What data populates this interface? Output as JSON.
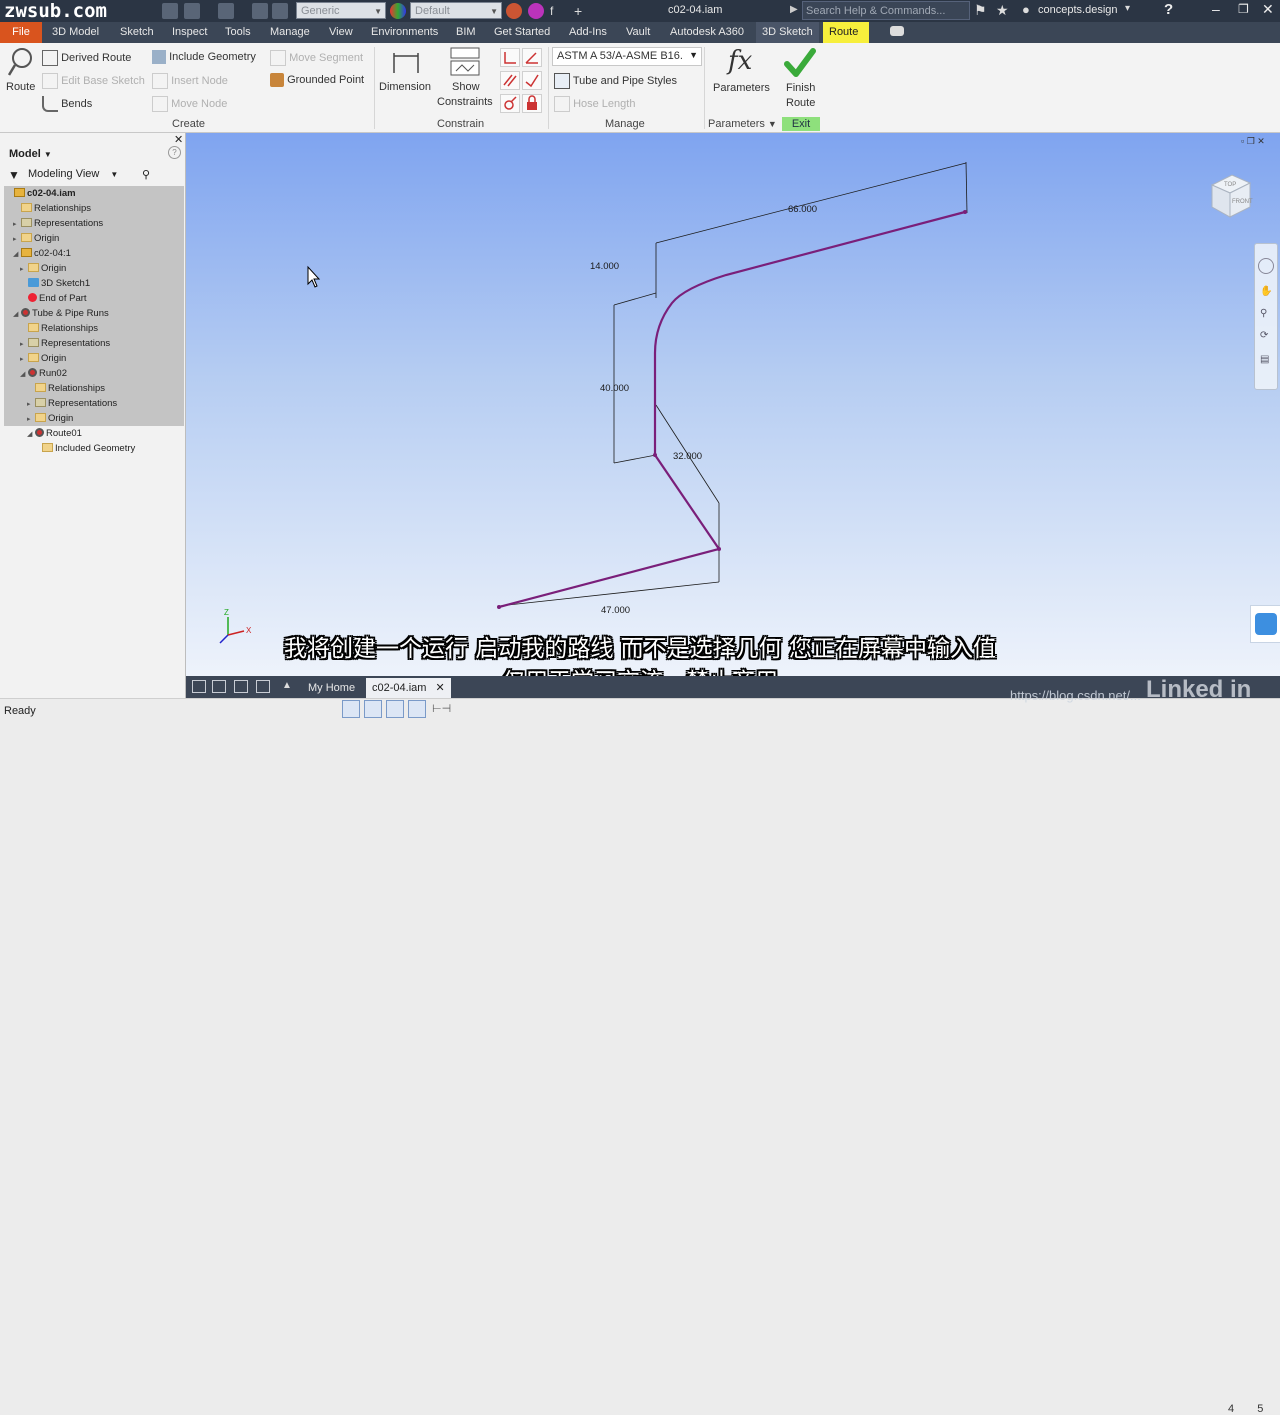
{
  "titlebar": {
    "logo": "zwsub.com",
    "combo_generic": "Generic",
    "combo_default": "Default",
    "doc_title": "c02-04.iam",
    "search_placeholder": "Search Help & Commands...",
    "user": "concepts.design"
  },
  "menu": {
    "items": [
      "File",
      "3D Model",
      "Sketch",
      "Inspect",
      "Tools",
      "Manage",
      "View",
      "Environments",
      "BIM",
      "Get Started",
      "Add-Ins",
      "Vault",
      "Autodesk A360",
      "3D Sketch",
      "Route"
    ],
    "active": "Route"
  },
  "ribbon": {
    "route": "Route",
    "derived_route": "Derived Route",
    "include_geometry": "Include Geometry",
    "move_segment": "Move Segment",
    "edit_base_sketch": "Edit Base Sketch",
    "insert_node": "Insert Node",
    "grounded_point": "Grounded Point",
    "bends": "Bends",
    "move_node": "Move Node",
    "create_label": "Create",
    "dimension": "Dimension",
    "show": "Show",
    "constraints": "Constraints",
    "constrain_label": "Constrain",
    "style_combo": "ASTM A 53/A-ASME B16.",
    "tube_pipe_styles": "Tube and Pipe Styles",
    "hose_length": "Hose Length",
    "manage_label": "Manage",
    "parameters": "Parameters",
    "parameters_label": "Parameters",
    "fx": "fx",
    "finish": "Finish",
    "route2": "Route",
    "exit_label": "Exit"
  },
  "browser": {
    "model": "Model",
    "view": "Modeling View",
    "nodes": [
      {
        "label": "c02-04.iam",
        "icon": "asm",
        "indent": 0,
        "tw": ""
      },
      {
        "label": "Relationships",
        "icon": "folder",
        "indent": 1,
        "tw": ""
      },
      {
        "label": "Representations",
        "icon": "rep",
        "indent": 1,
        "tw": "▸"
      },
      {
        "label": "Origin",
        "icon": "folder",
        "indent": 1,
        "tw": "▸"
      },
      {
        "label": "c02-04:1",
        "icon": "asm",
        "indent": 1,
        "tw": "◢"
      },
      {
        "label": "Origin",
        "icon": "folder",
        "indent": 2,
        "tw": "▸"
      },
      {
        "label": "3D Sketch1",
        "icon": "sk",
        "indent": 2,
        "tw": ""
      },
      {
        "label": "End of Part",
        "icon": "red",
        "indent": 2,
        "tw": ""
      },
      {
        "label": "Tube & Pipe Runs",
        "icon": "run",
        "indent": 1,
        "tw": "◢"
      },
      {
        "label": "Relationships",
        "icon": "folder",
        "indent": 2,
        "tw": ""
      },
      {
        "label": "Representations",
        "icon": "rep",
        "indent": 2,
        "tw": "▸"
      },
      {
        "label": "Origin",
        "icon": "folder",
        "indent": 2,
        "tw": "▸"
      },
      {
        "label": "Run02",
        "icon": "run",
        "indent": 2,
        "tw": "◢"
      },
      {
        "label": "Relationships",
        "icon": "folder",
        "indent": 3,
        "tw": ""
      },
      {
        "label": "Representations",
        "icon": "rep",
        "indent": 3,
        "tw": "▸"
      },
      {
        "label": "Origin",
        "icon": "folder",
        "indent": 3,
        "tw": "▸"
      },
      {
        "label": "Route01",
        "icon": "run",
        "indent": 3,
        "tw": "◢"
      },
      {
        "label": "Included Geometry",
        "icon": "folder",
        "indent": 4,
        "tw": ""
      }
    ]
  },
  "viewport": {
    "dims": [
      "66.000",
      "14.000",
      "40.000",
      "32.000",
      "47.000"
    ],
    "viewcube_top": "TOP",
    "viewcube_front": "FRONT",
    "axis_x": "X",
    "axis_z": "Z"
  },
  "subtitles": {
    "line1": "我将创建一个运行  启动我的路线  而不是选择几何  您正在屏幕中输入值",
    "line2": "仅用于学习交流，禁止商用"
  },
  "tabs": {
    "home": "My Home",
    "doc": "c02-04.iam"
  },
  "status": {
    "ready": "Ready",
    "watermark": "https://blog.csdn.net/...",
    "linkedin": "Linked in",
    "page_a": "4",
    "page_b": "5"
  },
  "colors": {
    "route_line": "#7a1f7a",
    "active_tab": "#f7ef3c",
    "file_tab": "#d9541e"
  }
}
